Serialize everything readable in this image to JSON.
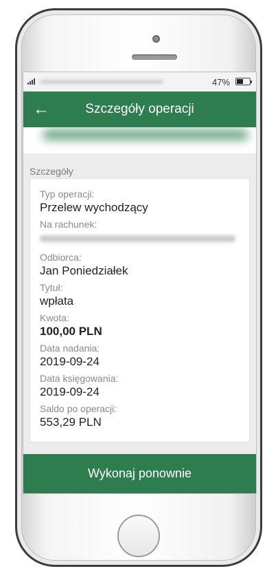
{
  "status_bar": {
    "battery_percent": "47%",
    "battery_level": 0.47
  },
  "app_bar": {
    "back_icon": "arrow-left-icon",
    "title": "Szczegóły operacji"
  },
  "section": {
    "label": "Szczegóły"
  },
  "details": {
    "operation_type_label": "Typ operacji:",
    "operation_type_value": "Przelew wychodzący",
    "account_label": "Na rachunek:",
    "recipient_label": "Odbiorca:",
    "recipient_value": "Jan Poniedziałek",
    "title_label": "Tytuł:",
    "title_value": "wpłata",
    "amount_label": "Kwota:",
    "amount_value": "100,00 PLN",
    "send_date_label": "Data nadania:",
    "send_date_value": "2019-09-24",
    "booking_date_label": "Data księgowania:",
    "booking_date_value": "2019-09-24",
    "balance_label": "Saldo po operacji:",
    "balance_value": "553,29 PLN"
  },
  "actions": {
    "repeat_label": "Wykonaj ponownie"
  },
  "colors": {
    "brand_green": "#2e7d4f",
    "background": "#ececec"
  }
}
